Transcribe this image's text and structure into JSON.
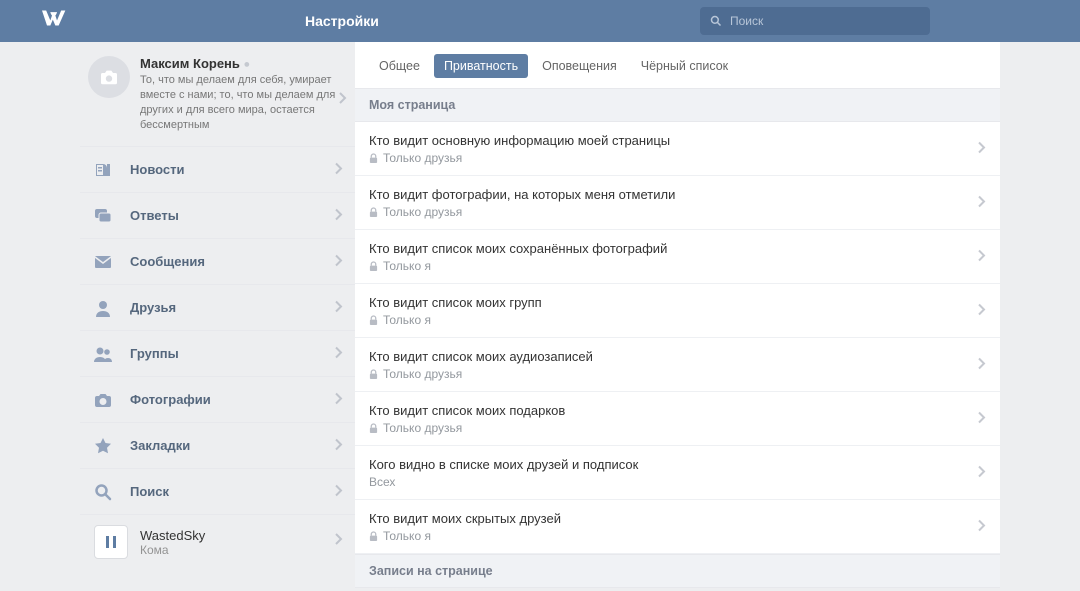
{
  "header": {
    "title": "Настройки",
    "search_placeholder": "Поиск"
  },
  "profile": {
    "name": "Максим Корень",
    "status": "То, что мы делаем для себя, умирает вместе с нами; то, что мы делаем для других и для всего мира, остается бессмертным"
  },
  "nav": [
    {
      "icon": "news",
      "label": "Новости"
    },
    {
      "icon": "replies",
      "label": "Ответы"
    },
    {
      "icon": "messages",
      "label": "Сообщения"
    },
    {
      "icon": "friends",
      "label": "Друзья"
    },
    {
      "icon": "groups",
      "label": "Группы"
    },
    {
      "icon": "photos",
      "label": "Фотографии"
    },
    {
      "icon": "bookmarks",
      "label": "Закладки"
    },
    {
      "icon": "search",
      "label": "Поиск"
    }
  ],
  "player": {
    "artist": "WastedSky",
    "track": "Кома"
  },
  "tabs": [
    {
      "label": "Общее",
      "active": false
    },
    {
      "label": "Приватность",
      "active": true
    },
    {
      "label": "Оповещения",
      "active": false
    },
    {
      "label": "Чёрный список",
      "active": false
    }
  ],
  "section1": "Моя страница",
  "rows": [
    {
      "q": "Кто видит основную информацию моей страницы",
      "v": "Только друзья",
      "lock": true
    },
    {
      "q": "Кто видит фотографии, на которых меня отметили",
      "v": "Только друзья",
      "lock": true
    },
    {
      "q": "Кто видит список моих сохранённых фотографий",
      "v": "Только я",
      "lock": true
    },
    {
      "q": "Кто видит список моих групп",
      "v": "Только я",
      "lock": true
    },
    {
      "q": "Кто видит список моих аудиозаписей",
      "v": "Только друзья",
      "lock": true
    },
    {
      "q": "Кто видит список моих подарков",
      "v": "Только друзья",
      "lock": true
    },
    {
      "q": "Кого видно в списке моих друзей и подписок",
      "v": "Всех",
      "lock": false
    },
    {
      "q": "Кто видит моих скрытых друзей",
      "v": "Только я",
      "lock": true
    }
  ],
  "section2": "Записи на странице"
}
